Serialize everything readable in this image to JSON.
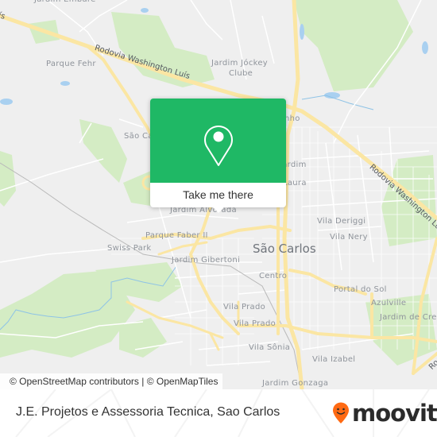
{
  "map": {
    "labels": {
      "jardim_embare": "Jardim Embare",
      "parque_fehr": "Parque Fehr",
      "jardim_jockey_clube_1": "Jardim Jóckey",
      "jardim_jockey_clube_2": "Clube",
      "sao_carlos_west": "São Ca",
      "jardim_right": "Jardim",
      "laura": "Laura",
      "sao_carlos_east_partial": "nho",
      "jardim_alvorada": "Jardim Alvorada",
      "parque_faber_ii": "Parque Faber II",
      "swiss_park": "Swiss Park",
      "jardim_gibertoni": "Jardim Gibertoni",
      "sao_carlos_city": "São Carlos",
      "centro": "Centro",
      "vila_deriggi": "Vila Deriggi",
      "vila_nery": "Vila Nery",
      "portal_do_sol": "Portal do Sol",
      "azulville": "Azulville",
      "jardim_de_cresci": "Jardim de Cre",
      "vila_prado_1": "Vila Prado",
      "vila_prado_2": "Vila Prado",
      "vila_sonia": "Vila Sônia",
      "vila_izabel": "Vila Izabel",
      "jardim_gonzaga": "Jardim Gonzaga",
      "rodovia_wl_1": "Rodovia Washington Luís",
      "rodovia_wl_2": "Rodovia Washington Luís",
      "rodovia_wl_3": "Ro",
      "rodovia_wl_left": "ís"
    },
    "colors": {
      "background": "#efefef",
      "park": "#d4ecc4",
      "water": "#a9d0f0",
      "major_road": "#fbe6a3",
      "minor_road": "#ffffff",
      "accent_green": "#1fb865",
      "moovit_orange": "#ff6a13"
    }
  },
  "popup": {
    "icon": "map-pin-icon",
    "button_label": "Take me there"
  },
  "attribution": {
    "text": "© OpenStreetMap contributors | © OpenMapTiles"
  },
  "footer": {
    "place_name": "J.E. Projetos e Assessoria Tecnica, Sao Carlos",
    "brand_name": "moovit",
    "brand_icon": "moovit-logo-icon"
  }
}
